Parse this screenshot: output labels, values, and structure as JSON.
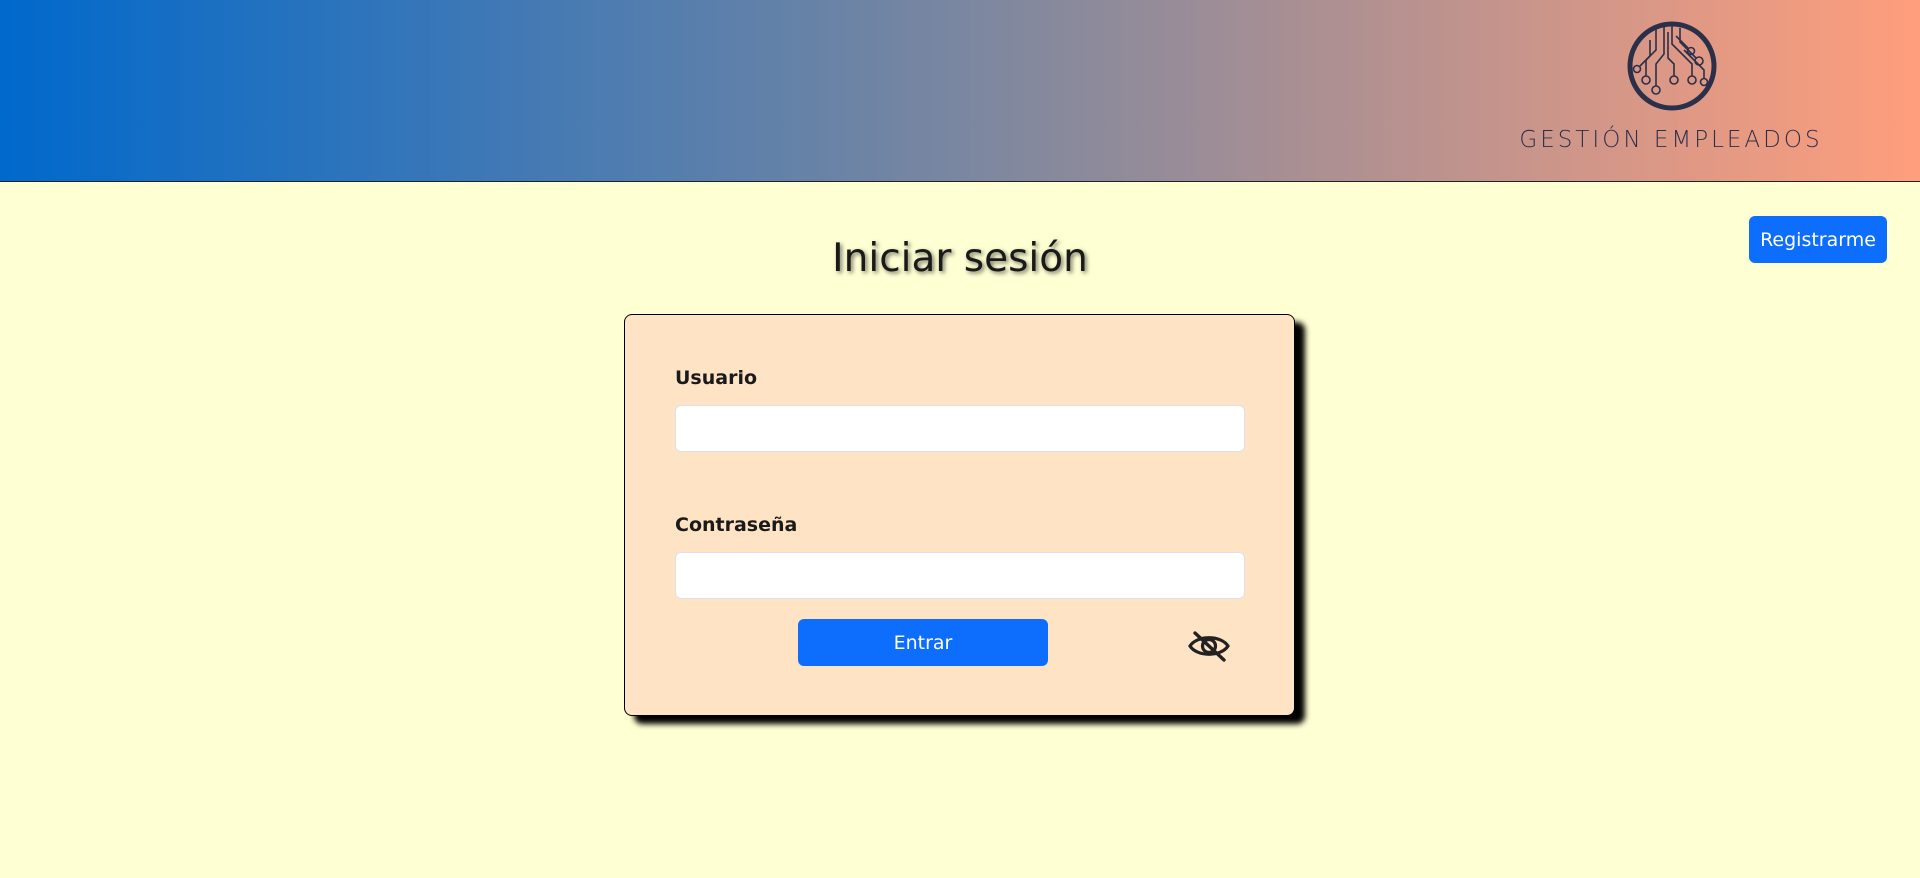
{
  "header": {
    "logo_text": "GESTIÓN EMPLEADOS",
    "gradient_colors": [
      "#0069cc",
      "#ff9e7c"
    ]
  },
  "nav": {
    "register_label": "Registrarme"
  },
  "main": {
    "title": "Iniciar sesión"
  },
  "form": {
    "username": {
      "label": "Usuario",
      "value": ""
    },
    "password": {
      "label": "Contraseña",
      "value": ""
    },
    "submit_label": "Entrar",
    "toggle_icon": "eye-slash-icon"
  },
  "colors": {
    "background": "#ffffd4",
    "card": "#fee3c4",
    "primary": "#0d6efd",
    "logo": "#2b304a"
  }
}
